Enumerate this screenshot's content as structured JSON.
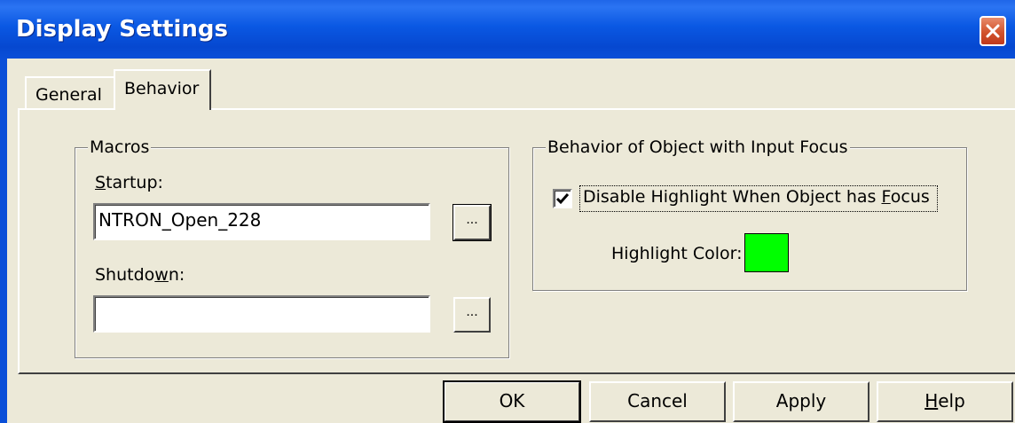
{
  "window": {
    "title": "Display Settings"
  },
  "tabs": [
    {
      "label": "General",
      "active": false
    },
    {
      "label": "Behavior",
      "active": true
    }
  ],
  "macros": {
    "group_label": "Macros",
    "startup_label_prefix": "",
    "startup_label_mnemonic": "S",
    "startup_label_rest": "tartup:",
    "startup_value": "NTRON_Open_228",
    "shutdown_label_prefix": "Shutdo",
    "shutdown_label_mnemonic": "w",
    "shutdown_label_rest": "n:",
    "shutdown_value": "",
    "browse_label": "..."
  },
  "focus_behavior": {
    "group_label": "Behavior of Object with Input Focus",
    "checkbox_label_prefix": "Disable Highlight When Object has ",
    "checkbox_label_mnemonic": "F",
    "checkbox_label_rest": "ocus",
    "checkbox_checked": true,
    "highlight_color_label": "Highlight Color:",
    "highlight_color": "#00ff00"
  },
  "buttons": {
    "ok": "OK",
    "cancel": "Cancel",
    "apply": "Apply",
    "help_mnemonic": "H",
    "help_rest": "elp"
  }
}
